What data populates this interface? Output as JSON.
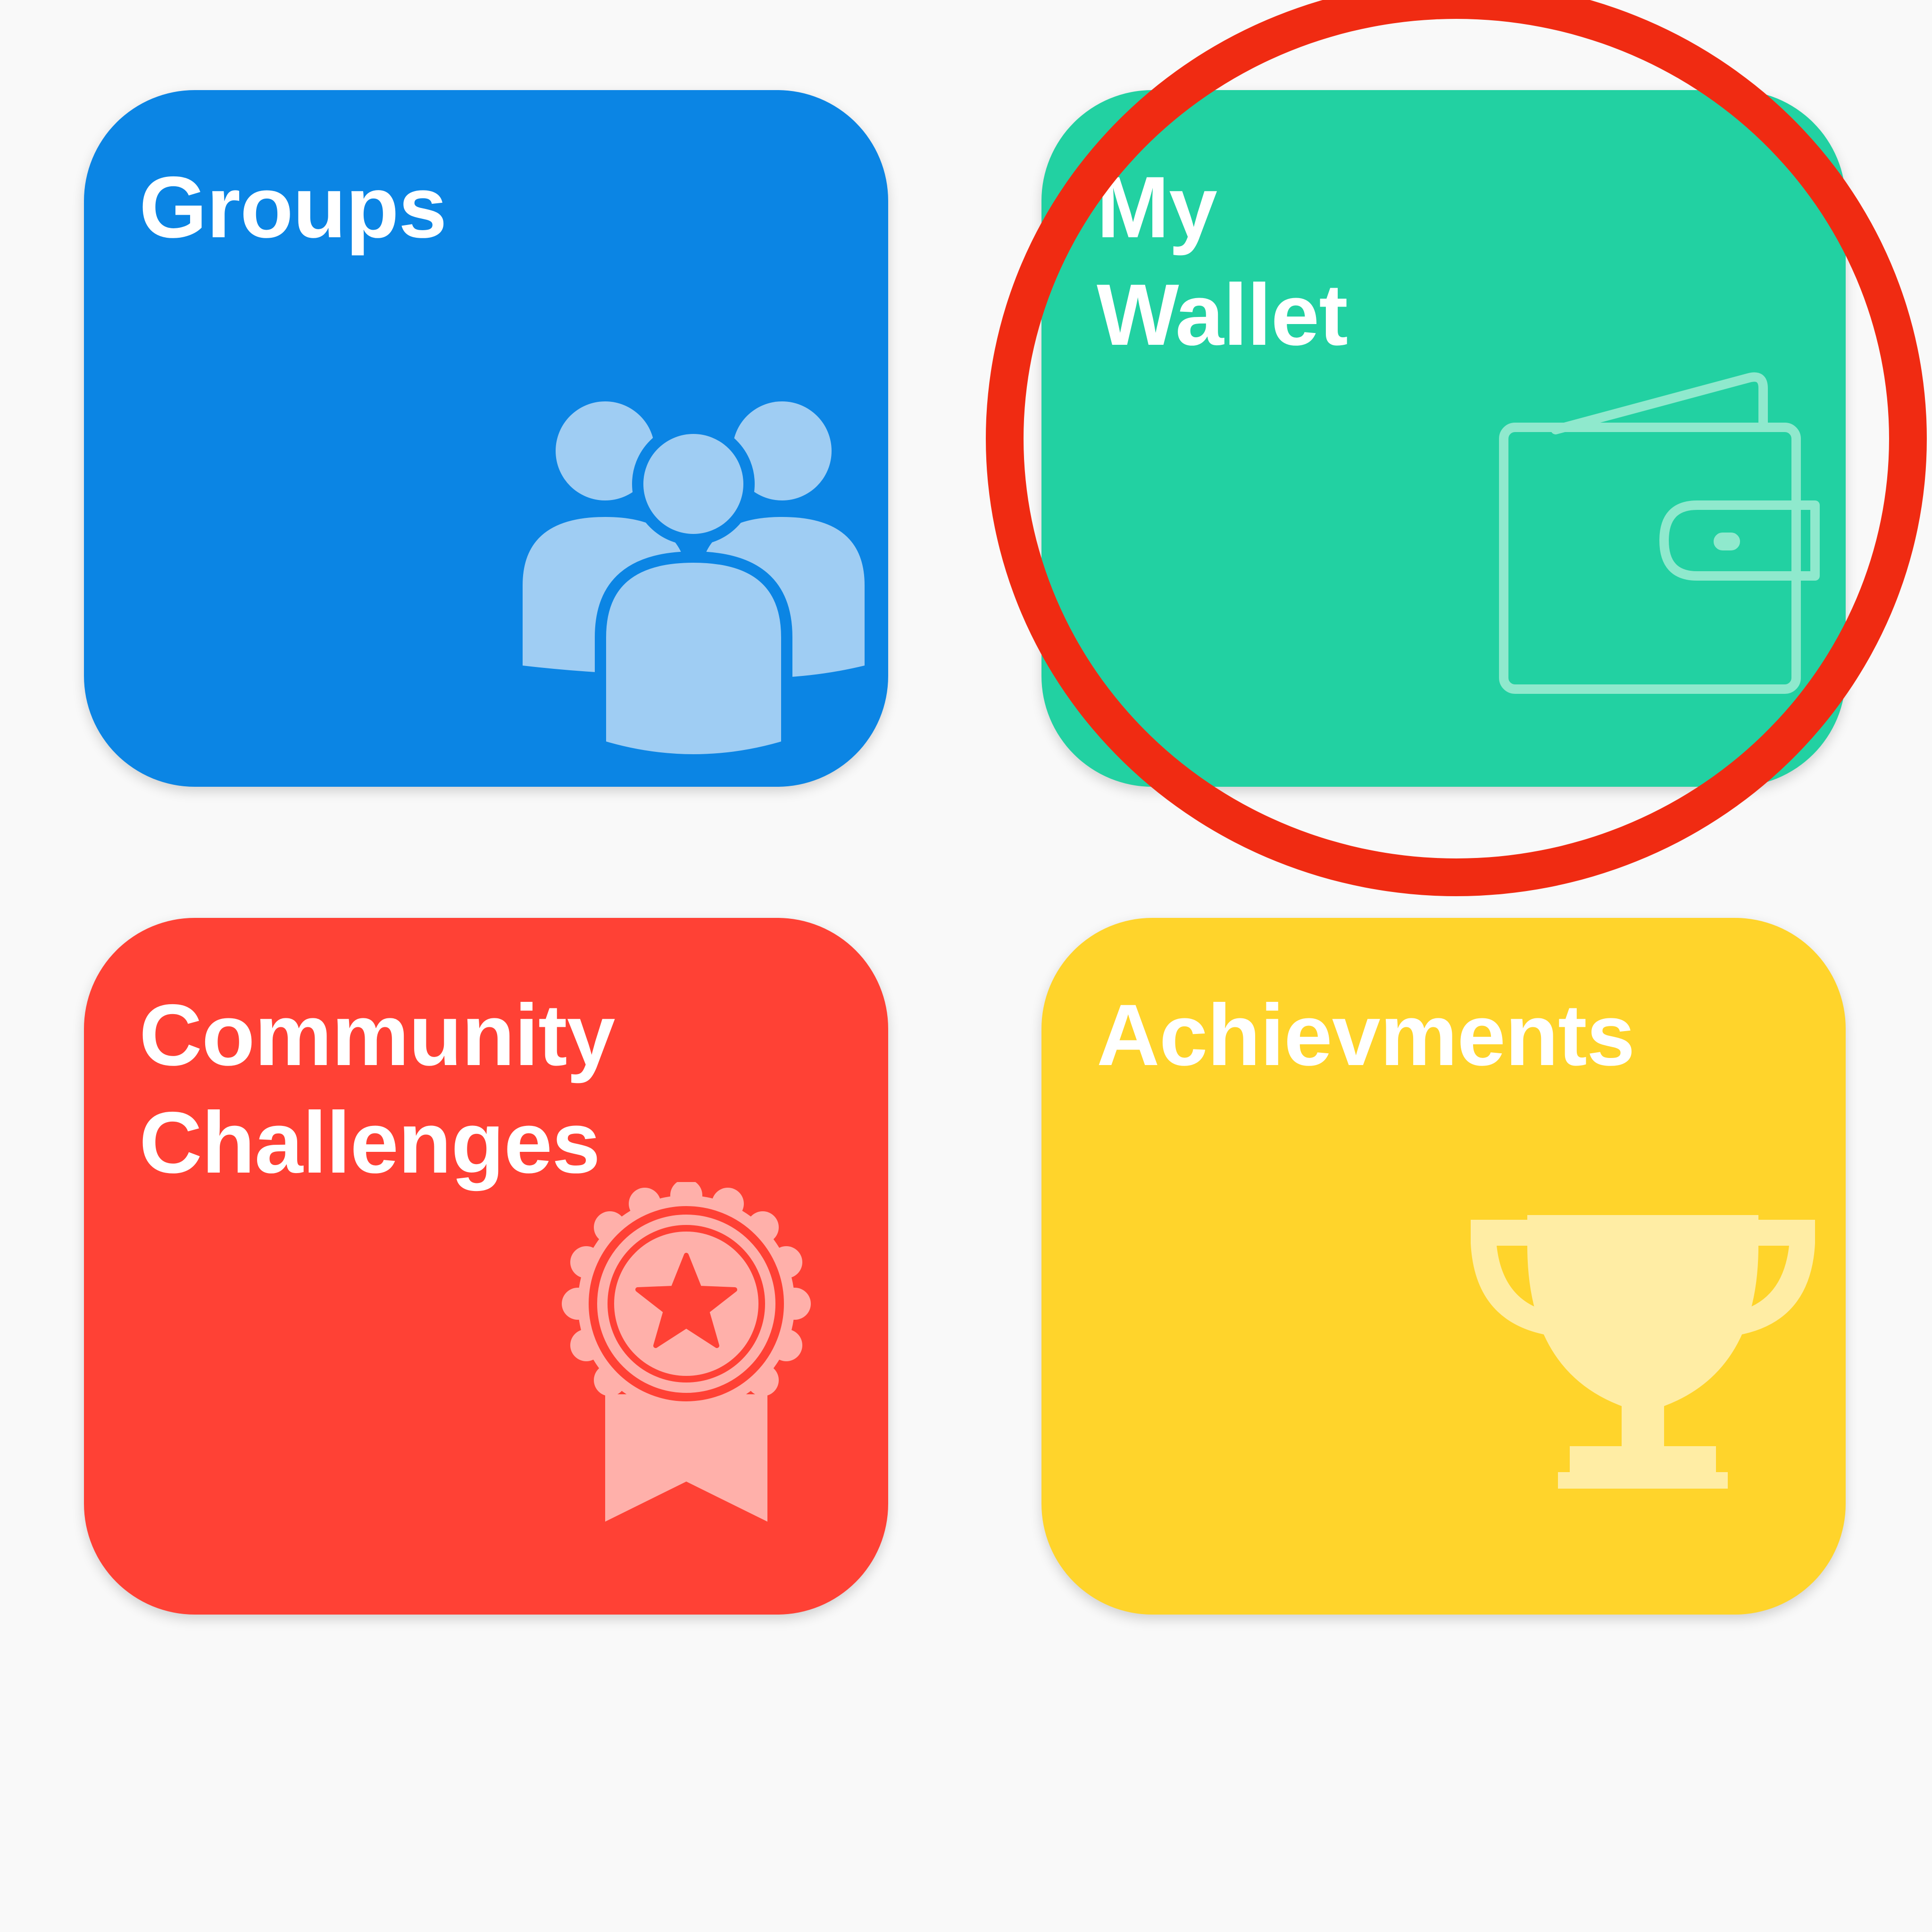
{
  "tiles": {
    "groups": {
      "label": "Groups",
      "color": "#0b85e4",
      "icon": "people-group-icon"
    },
    "wallet": {
      "label_line1": "My",
      "label_line2": "Wallet",
      "color": "#22d1a2",
      "icon": "wallet-icon"
    },
    "challenges": {
      "label_line1": "Community",
      "label_line2": "Challenges",
      "color": "#ff4135",
      "icon": "award-ribbon-icon"
    },
    "achievements": {
      "label": "Achievments",
      "color": "#ffd42b",
      "icon": "trophy-icon"
    }
  },
  "annotation": {
    "highlight_color": "#f02b12",
    "highlighted_tile": "wallet"
  }
}
